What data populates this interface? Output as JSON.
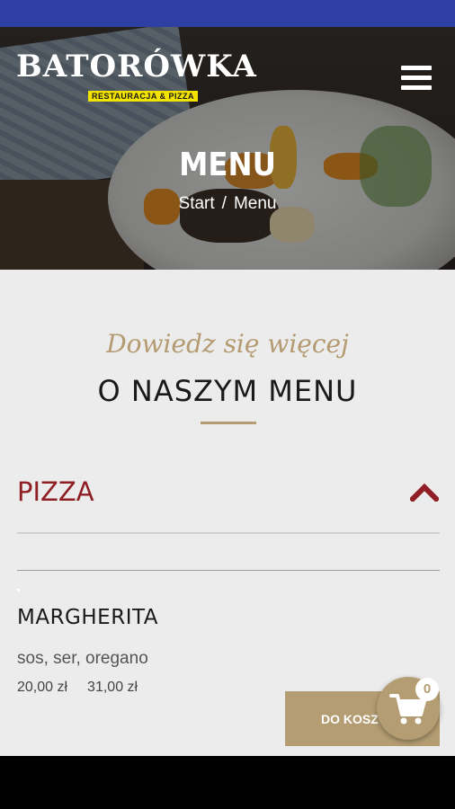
{
  "brand": {
    "name": "BATORÓWKA",
    "tagline": "RESTAURACJA & PIZZA"
  },
  "hero": {
    "title": "MENU",
    "breadcrumb": {
      "home": "Start",
      "separator": "/",
      "current": "Menu"
    }
  },
  "section": {
    "subtitle": "Dowiedz się więcej",
    "title": "O NASZYM MENU"
  },
  "category": {
    "name": "PIZZA",
    "expanded": true
  },
  "items": [
    {
      "name": "MARGHERITA",
      "description": "sos, ser, oregano",
      "prices": [
        "20,00 zł",
        "31,00 zł"
      ],
      "add_label": "DO KOSZYKA"
    }
  ],
  "cart": {
    "count": "0"
  },
  "colors": {
    "status_bar": "#2e3fa3",
    "accent_gold": "#b49d72",
    "category_red": "#8f1f24",
    "content_bg": "#ececec"
  }
}
